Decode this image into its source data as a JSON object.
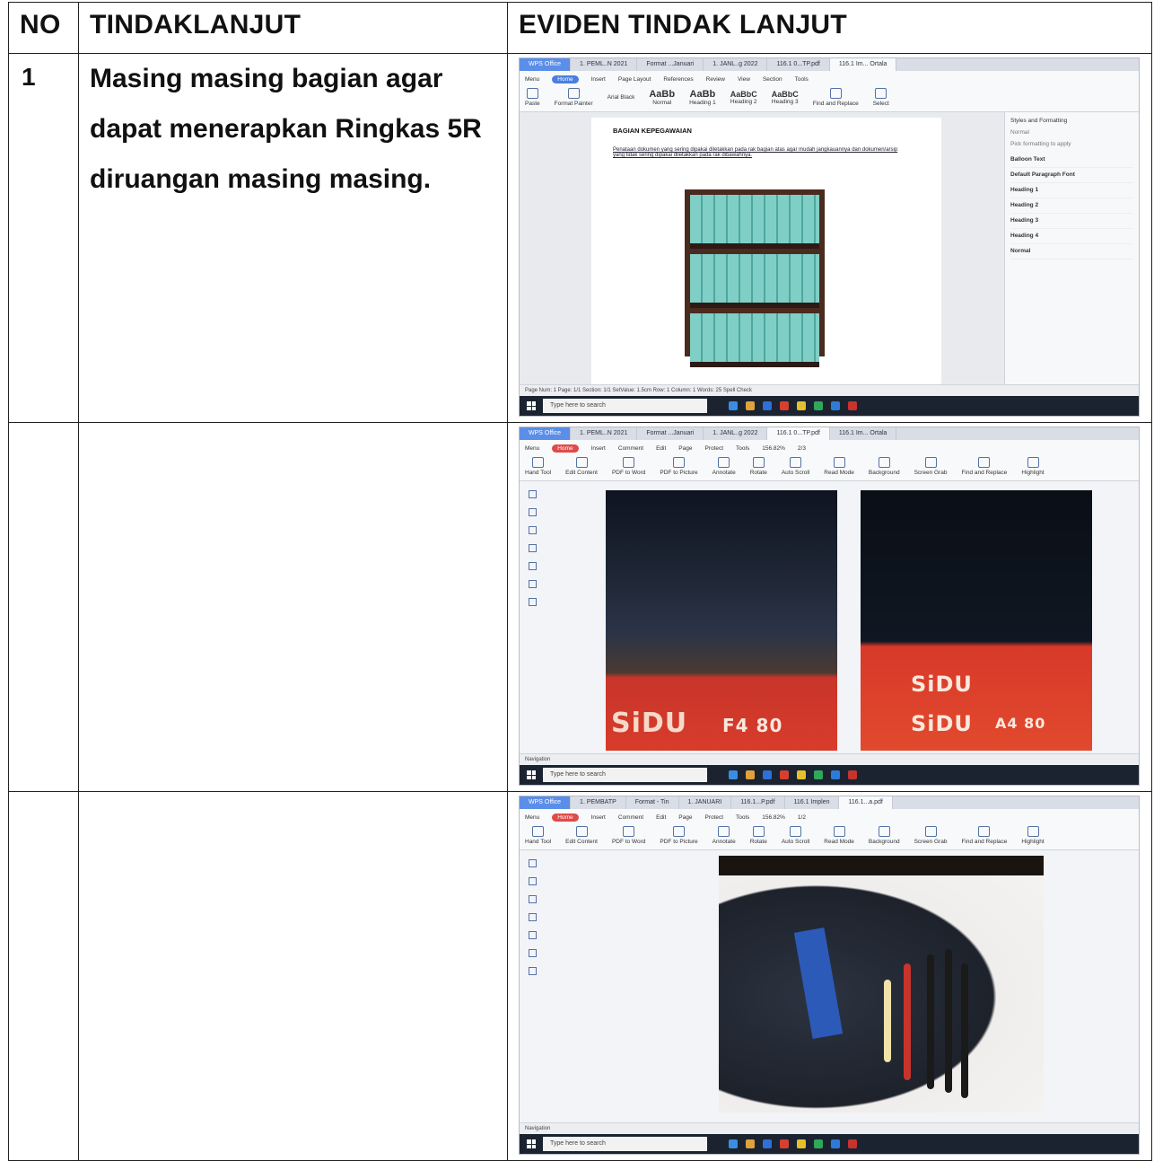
{
  "table": {
    "headers": {
      "no": "NO",
      "action": "TINDAKLANJUT",
      "evidence": "EVIDEN TINDAK LANJUT"
    },
    "row1": {
      "no": "1",
      "lines": [
        "Masing masing bagian agar",
        "dapat menerapkan Ringkas 5R",
        "diruangan masing masing."
      ]
    }
  },
  "shot1": {
    "tabs": [
      "WPS Office",
      "1. PEML..N 2021",
      "Format ...Januari",
      "1. JANL..g 2022",
      "116.1 0...TP.pdf",
      "116.1 Im... Ortala"
    ],
    "menu": [
      "Menu",
      "Home",
      "Insert",
      "Page Layout",
      "References",
      "Review",
      "View",
      "Section",
      "Tools"
    ],
    "tools": [
      "Paste",
      "Format Painter",
      "Arial Black",
      "Normal",
      "Heading 1",
      "Heading 2",
      "Heading 3",
      "Find and Replace",
      "Select"
    ],
    "doc_heading": "BAGIAN KEPEGAWAIAN",
    "doc_text": "Penataan dokumen yang sering dipakai diletakkan pada rak bagian atas agar mudah jangkauannya dan dokumen/arsip yang tidak sering dipakai diletakkan pada rak dibawahnya.",
    "pane_title": "Styles and Formatting",
    "pane_current": "Normal",
    "pane_caption": "Pick formatting to apply",
    "styles": [
      "Balloon Text",
      "Default Paragraph Font",
      "Heading 1",
      "Heading 2",
      "Heading 3",
      "Heading 4",
      "Normal"
    ],
    "status": "Page Num: 1   Page: 1/1   Section: 1/1   SetValue: 1.5cm   Row: 1   Column: 1   Words: 25   Spell Check",
    "search": "Type here to search"
  },
  "shot2": {
    "tabs": [
      "WPS Office",
      "1. PEML..N 2021",
      "Format ...Januari",
      "1. JANL..g 2022",
      "116.1 0...TP.pdf",
      "116.1 Im... Ortala"
    ],
    "menu": [
      "Menu",
      "Home",
      "Insert",
      "Comment",
      "Edit",
      "Page",
      "Protect",
      "Tools"
    ],
    "tools": [
      "Hand Tool",
      "Edit Content",
      "PDF to Word",
      "PDF to Picture",
      "Annotate",
      "Rotate",
      "Auto Scroll",
      "Read Mode",
      "Background",
      "Screen Grab",
      "Find and Replace",
      "Highlight"
    ],
    "zoom": "156.82%",
    "page": "2/3",
    "brand_a": "SiDU",
    "size_a": "F4 80",
    "brand_b": "SiDU",
    "size_b": "A4 80",
    "nav": "Navigation",
    "search": "Type here to search"
  },
  "shot3": {
    "tabs": [
      "WPS Office",
      "1. PEMBATP",
      "Format - Tin",
      "1. JANUARI",
      "116.1...P.pdf",
      "116.1 Implen",
      "116.1...a.pdf"
    ],
    "menu": [
      "Menu",
      "Home",
      "Insert",
      "Comment",
      "Edit",
      "Page",
      "Protect",
      "Tools"
    ],
    "tools": [
      "Hand Tool",
      "Edit Content",
      "PDF to Word",
      "PDF to Picture",
      "Annotate",
      "Rotate",
      "Auto Scroll",
      "Read Mode",
      "Background",
      "Screen Grab",
      "Find and Replace",
      "Highlight"
    ],
    "zoom": "156.82%",
    "page": "1/2",
    "nav": "Navigation",
    "search": "Type here to search"
  },
  "colors": {
    "taskbar": "#1b2330",
    "accent": "#4a7fe0",
    "sidu_red": "#d83c2b"
  }
}
